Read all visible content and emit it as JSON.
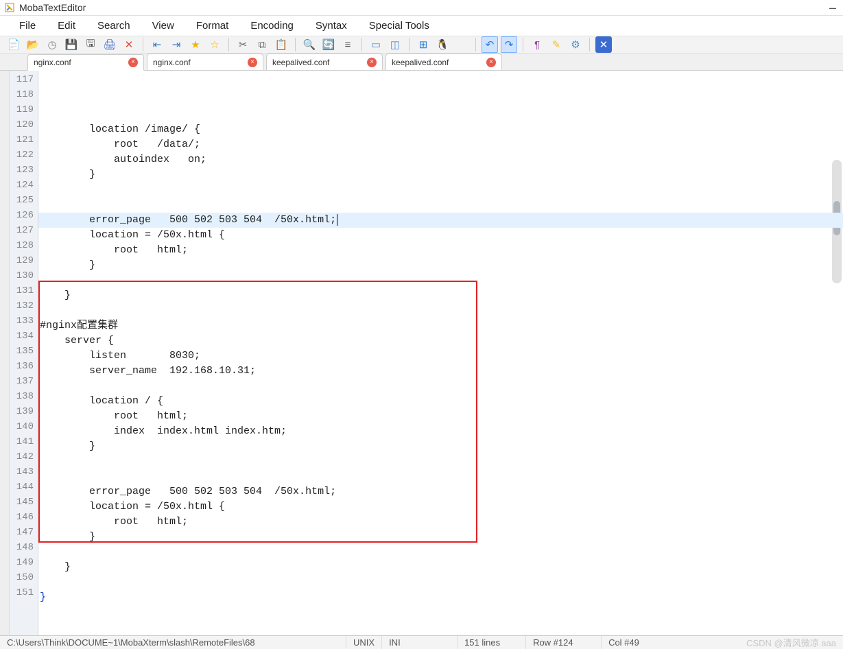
{
  "app": {
    "title": "MobaTextEditor"
  },
  "menu": [
    "File",
    "Edit",
    "Search",
    "View",
    "Format",
    "Encoding",
    "Syntax",
    "Special Tools"
  ],
  "toolbar": {
    "icons": [
      {
        "name": "new-file-icon",
        "glyph": "📄",
        "color": "#4aa3ff"
      },
      {
        "name": "open-folder-icon",
        "glyph": "📂",
        "color": "#f6b64a"
      },
      {
        "name": "history-icon",
        "glyph": "◷",
        "color": "#888"
      },
      {
        "name": "save-icon",
        "glyph": "💾",
        "color": "#555"
      },
      {
        "name": "save-all-icon",
        "glyph": "🖫",
        "color": "#555"
      },
      {
        "name": "print-icon",
        "glyph": "🖨",
        "color": "#3b6bd1"
      },
      {
        "name": "close-icon",
        "glyph": "✕",
        "color": "#e24a3b"
      },
      {
        "sep": true
      },
      {
        "name": "outdent-icon",
        "glyph": "⇤",
        "color": "#3273c9"
      },
      {
        "name": "indent-icon",
        "glyph": "⇥",
        "color": "#3273c9"
      },
      {
        "name": "bookmark-add-icon",
        "glyph": "★",
        "color": "#f1b500"
      },
      {
        "name": "bookmark-next-icon",
        "glyph": "☆",
        "color": "#f1b500"
      },
      {
        "sep": true
      },
      {
        "name": "cut-icon",
        "glyph": "✂",
        "color": "#666"
      },
      {
        "name": "copy-icon",
        "glyph": "⧉",
        "color": "#666"
      },
      {
        "name": "paste-icon",
        "glyph": "📋",
        "color": "#666"
      },
      {
        "sep": true
      },
      {
        "name": "find-icon",
        "glyph": "🔍",
        "color": "#4a90d9"
      },
      {
        "name": "find-replace-icon",
        "glyph": "🔄",
        "color": "#4a90d9"
      },
      {
        "name": "goto-icon",
        "glyph": "≡",
        "color": "#555"
      },
      {
        "sep": true
      },
      {
        "name": "select-word-icon",
        "glyph": "▭",
        "color": "#4a90d9"
      },
      {
        "name": "select-all-icon",
        "glyph": "◫",
        "color": "#4a90d9"
      },
      {
        "sep": true
      },
      {
        "name": "windows-icon",
        "glyph": "⊞",
        "color": "#2a7ad4"
      },
      {
        "name": "linux-icon",
        "glyph": "🐧",
        "color": "#333"
      },
      {
        "name": "mac-icon",
        "glyph": "",
        "color": "#4aa3ff"
      },
      {
        "sep": true
      },
      {
        "name": "undo-icon",
        "glyph": "↶",
        "color": "#2a7ad4",
        "pressed": true
      },
      {
        "name": "redo-icon",
        "glyph": "↷",
        "color": "#2a7ad4",
        "pressed": true
      },
      {
        "sep": true
      },
      {
        "name": "show-symbols-icon",
        "glyph": "¶",
        "color": "#9a4aa8"
      },
      {
        "name": "highlight-icon",
        "glyph": "✎",
        "color": "#e9c23b"
      },
      {
        "name": "settings-icon",
        "glyph": "⚙",
        "color": "#4a90d9"
      },
      {
        "sep": true
      },
      {
        "name": "exit-icon",
        "glyph": "✕",
        "color": "#fff",
        "bg": "#3b6bd1"
      }
    ]
  },
  "tabs": [
    {
      "label": "nginx.conf",
      "active": true
    },
    {
      "label": "nginx.conf",
      "active": false
    },
    {
      "label": "keepalived.conf",
      "active": false
    },
    {
      "label": "keepalived.conf",
      "active": false
    }
  ],
  "editor": {
    "first_line": 117,
    "active_line": 124,
    "lines": [
      "",
      "        location /image/ {",
      "            root   /data/;",
      "            autoindex   on;",
      "        }",
      "",
      "",
      "        error_page   500 502 503 504  /50x.html;",
      "        location = /50x.html {",
      "            root   html;",
      "        }",
      "",
      "    }",
      "",
      "#nginx配置集群",
      "    server {",
      "        listen       8030;",
      "        server_name  192.168.10.31;",
      "",
      "        location / {",
      "            root   html;",
      "            index  index.html index.htm;",
      "        }",
      "",
      "",
      "        error_page   500 502 503 504  /50x.html;",
      "        location = /50x.html {",
      "            root   html;",
      "        }",
      "",
      "    }",
      "",
      "}",
      "",
      ""
    ],
    "redbox_start": 131,
    "redbox_end": 147
  },
  "status": {
    "path": "C:\\Users\\Think\\DOCUME~1\\MobaXterm\\slash\\RemoteFiles\\68",
    "line_ending": "UNIX",
    "syntax": "INI",
    "lines": "151 lines",
    "row": "Row #124",
    "col": "Col #49",
    "watermark": "CSDN @清风微凉 aaa"
  }
}
